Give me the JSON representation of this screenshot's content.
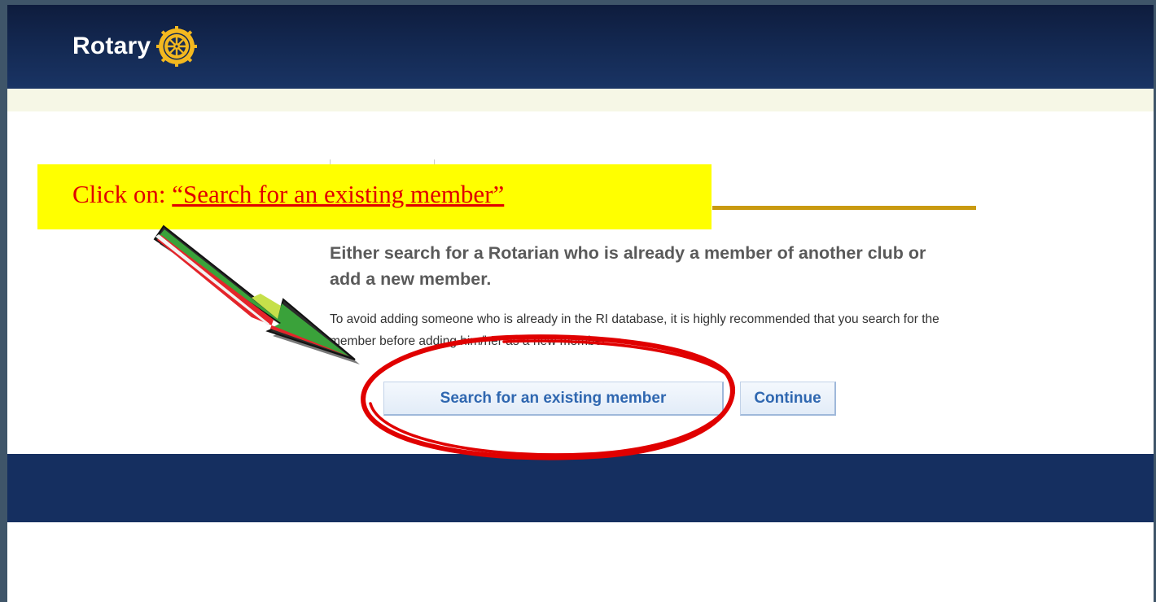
{
  "brand": {
    "name": "Rotary",
    "logo_icon": "rotary-wheel-icon"
  },
  "callout": {
    "prefix": "Click on: ",
    "link_text": "“Search for an existing member”",
    "text_color": "#e00000",
    "background": "#ffff00"
  },
  "main": {
    "heading": "Either search for a Rotarian who is already a member of another club or add a new member.",
    "description": "To avoid adding someone who is already in the RI database, it is highly recommended that you search for the member before adding him/her as a new member."
  },
  "buttons": {
    "search_label": "Search for an existing member",
    "continue_label": "Continue"
  },
  "colors": {
    "header": "#142a54",
    "footer": "#152f60",
    "accent_gold": "#c99a10",
    "button_text": "#2f67b0",
    "annotation_red": "#e00000"
  },
  "annotations": {
    "arrow_icon": "red-arrow-icon",
    "circle_icon": "red-ellipse-highlight"
  }
}
